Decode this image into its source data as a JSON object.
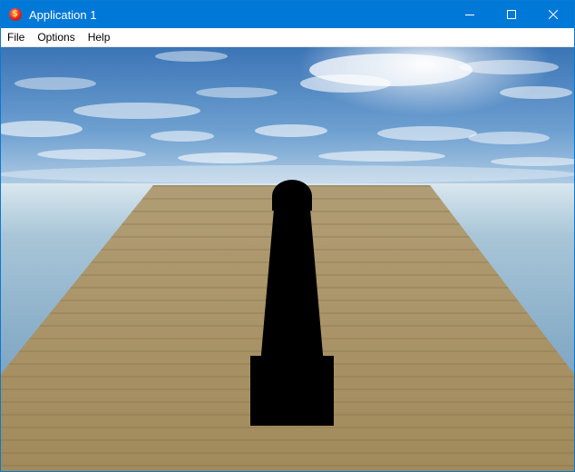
{
  "window": {
    "title": "Application 1",
    "icon": "app-icon",
    "controls": {
      "minimize_icon": "minimize-icon",
      "maximize_icon": "maximize-icon",
      "close_icon": "close-icon"
    }
  },
  "menu": {
    "items": [
      {
        "label": "File"
      },
      {
        "label": "Options"
      },
      {
        "label": "Help"
      }
    ]
  },
  "scene": {
    "colors": {
      "titlebar": "#0078d7",
      "sky_top": "#3d75b8",
      "horizon": "#d8e6ee",
      "sea": "#7ea7c2",
      "deck": "#b39c6e",
      "object": "#000000"
    }
  }
}
